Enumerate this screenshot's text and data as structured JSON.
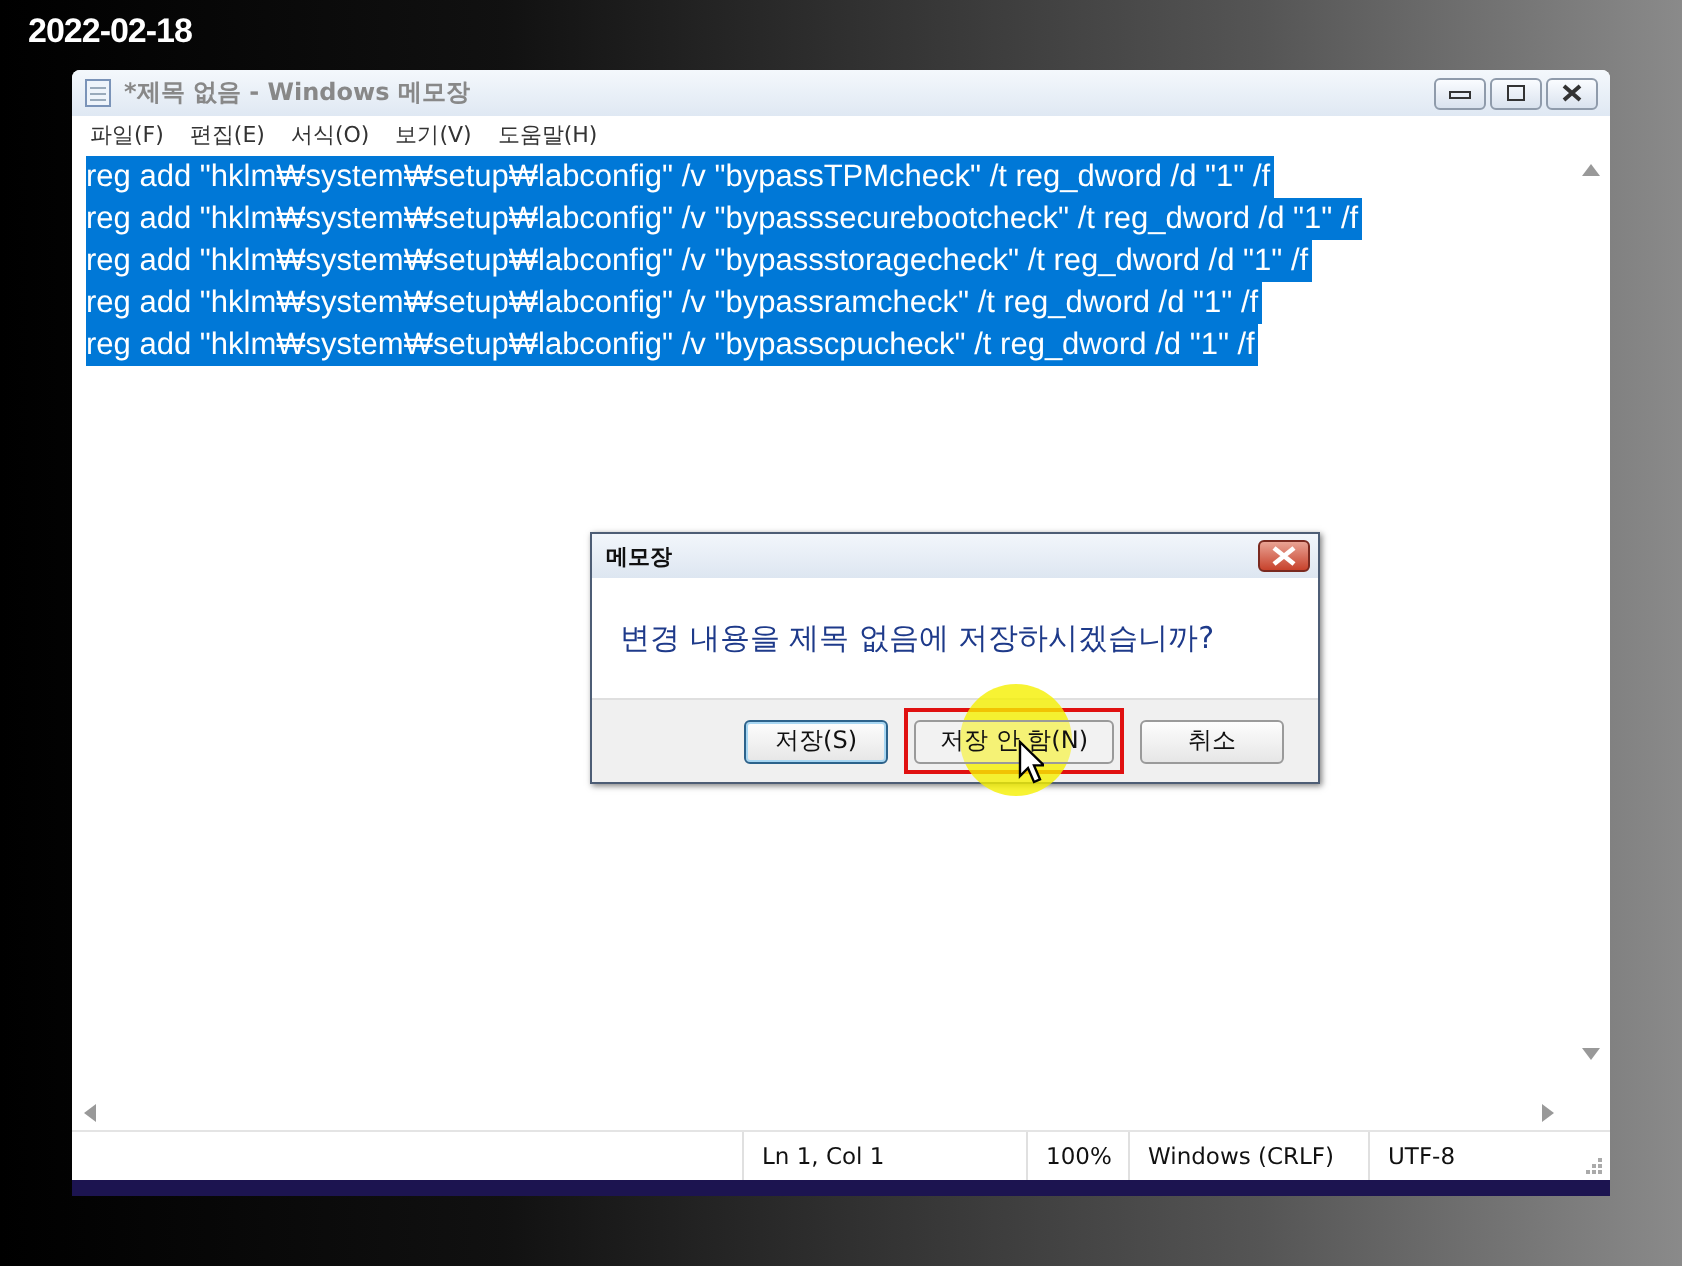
{
  "date": "2022-02-18",
  "window": {
    "title": "*제목 없음 - Windows 메모장"
  },
  "menu": [
    "파일(F)",
    "편집(E)",
    "서식(O)",
    "보기(V)",
    "도움말(H)"
  ],
  "lines": [
    {
      "text": "reg add \"hklm₩system₩setup₩labconfig\" /v \"bypassTPMcheck\" /t reg_dword /d \"1\" /f",
      "selected": true
    },
    {
      "text": "reg add \"hklm₩system₩setup₩labconfig\" /v \"bypasssecurebootcheck\" /t reg_dword /d \"1\" /f",
      "selected": true
    },
    {
      "text": "reg add \"hklm₩system₩setup₩labconfig\" /v \"bypassstoragecheck\" /t reg_dword /d \"1\" /f",
      "selected": true
    },
    {
      "text": "reg add \"hklm₩system₩setup₩labconfig\" /v \"bypassramcheck\" /t reg_dword /d \"1\" /f",
      "selected": true
    },
    {
      "text": "reg add \"hklm₩system₩setup₩labconfig\" /v \"bypasscpucheck\" /t reg_dword /d \"1\" /f",
      "selected": true
    }
  ],
  "dialog": {
    "title": "메모장",
    "message": "변경 내용을 제목 없음에 저장하시겠습니까?",
    "buttons": [
      {
        "label": "저장(S)",
        "focused": true,
        "highlighted": false
      },
      {
        "label": "저장 안 함(N)",
        "focused": false,
        "highlighted": true
      },
      {
        "label": "취소",
        "focused": false,
        "highlighted": false
      }
    ]
  },
  "status_bar": [
    "Ln 1, Col 1",
    "100%",
    "Windows (CRLF)",
    "UTF-8"
  ]
}
